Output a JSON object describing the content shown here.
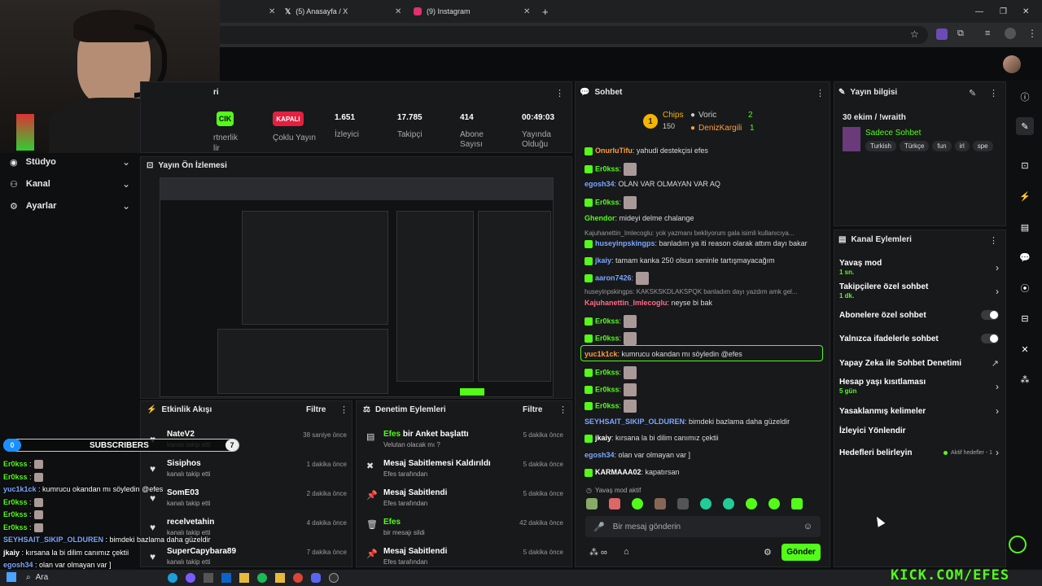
{
  "browser": {
    "tabs": [
      {
        "label": "(5) Anasayfa / X"
      },
      {
        "label": "(9) Instagram"
      }
    ]
  },
  "stats": {
    "status_label": "CIK",
    "status_partner": "rtnerlik",
    "status_partner2": "lir",
    "multi_badge": "KAPALI",
    "multi_label": "Çoklu Yayın",
    "viewers_value": "1.651",
    "viewers_label": "İzleyici",
    "followers_value": "17.785",
    "followers_label": "Takipçi",
    "subs_value": "414",
    "subs_label_1": "Abone",
    "subs_label_2": "Sayısı",
    "uptime_value": "00:49:03",
    "uptime_label_1": "Yayında",
    "uptime_label_2": "Olduğu",
    "header_partial": "ri"
  },
  "left_nav": {
    "items": [
      {
        "label": "Stüdyo"
      },
      {
        "label": "Kanal"
      },
      {
        "label": "Ayarlar"
      }
    ]
  },
  "preview": {
    "title": "Yayın Ön İzlemesi"
  },
  "activity": {
    "title": "Etkinlik Akışı",
    "filter": "Filtre",
    "items": [
      {
        "name": "NateV2",
        "sub": "kanalı takip etti",
        "time": "38 saniye önce"
      },
      {
        "name": "Sisiphos",
        "sub": "kanalı takip etti",
        "time": "1 dakika önce"
      },
      {
        "name": "SomE03",
        "sub": "kanalı takip etti",
        "time": "2 dakika önce"
      },
      {
        "name": "recelvetahin",
        "sub": "kanalı takip etti",
        "time": "4 dakika önce"
      },
      {
        "name": "SuperCapybara89",
        "sub": "kanalı takip etti",
        "time": "7 dakika önce"
      }
    ]
  },
  "moderation": {
    "title": "Denetim Eylemleri",
    "filter": "Filtre",
    "items": [
      {
        "name": "Efes",
        "action": " bir Anket başlattı",
        "sub": "Velutan olacak mı ?",
        "time": "5 dakika önce"
      },
      {
        "name": "Mesaj Sabitlemesi Kaldırıldı",
        "action": "",
        "sub": "Efes tarafından",
        "time": "5 dakika önce"
      },
      {
        "name": "Mesaj Sabitlendi",
        "action": "",
        "sub": "Efes tarafından",
        "time": "5 dakika önce"
      },
      {
        "name": "Efes",
        "action": "",
        "sub": "bir mesajı sildi",
        "time": "42 dakika önce"
      },
      {
        "name": "Mesaj Sabitlendi",
        "action": "",
        "sub": "Efes tarafından",
        "time": "5 dakika önce"
      }
    ]
  },
  "chat": {
    "title": "Sohbet",
    "chips_label": "Chips",
    "chips_value": "150",
    "top1": "Voric",
    "top1_count": "2",
    "top2": "DenizKargili",
    "top2_count": "1",
    "slow_mode_notice": "Yavaş mod aktif",
    "input_placeholder": "Bir mesaj gönderin",
    "send_label": "Gönder",
    "messages": [
      {
        "user": "OnurluTifu",
        "text": ": yahudi destekçisi efes"
      },
      {
        "user": "Er0kss",
        "text": ":"
      },
      {
        "user": "egosh34",
        "text": ": OLAN VAR OLMAYAN VAR AQ"
      },
      {
        "user": "Er0kss",
        "text": ":"
      },
      {
        "user": "Ghendor",
        "text": ": mideyi delme chalange"
      },
      {
        "user": "Kajuhanettin_Imlecoglu",
        "text": ": yok yazmanı bekliyorum gala isimli kullanıcıya..."
      },
      {
        "user": "huseyinpskingps",
        "text": ": banladım ya iti reason olarak attım dayı bakar"
      },
      {
        "user": "jkaiy",
        "text": ": tamam kanka 250 olsun seninle tartışmayacağım"
      },
      {
        "user": "aaron7426",
        "text": ":"
      },
      {
        "user": "huseyinpskingps",
        "text": ": KAKSKSKDLAKSPQK banladım dayı yazdım amk gel..."
      },
      {
        "user": "Kajuhanettin_Imlecoglu",
        "text": ": neyse bi bak"
      },
      {
        "user": "Er0kss",
        "text": ":"
      },
      {
        "user": "Er0kss",
        "text": ":"
      },
      {
        "user": "yuc1k1ck",
        "text": ": kumrucu okandan mı söyledin @efes"
      },
      {
        "user": "Er0kss",
        "text": ":"
      },
      {
        "user": "Er0kss",
        "text": ":"
      },
      {
        "user": "Er0kss",
        "text": ":"
      },
      {
        "user": "SEYHSAIT_SIKIP_OLDUREN",
        "text": ": bimdeki bazlama daha güzeldir"
      },
      {
        "user": "jkaiy",
        "text": ": kırsana la bi dilim canımız çektii"
      },
      {
        "user": "egosh34",
        "text": ": olan var olmayan var ]"
      },
      {
        "user": "KARMAAA02",
        "text": ": kapatırsan"
      }
    ]
  },
  "stream_info": {
    "title": "Yayın bilgisi",
    "stream_title": "30 ekim / !wraith",
    "category": "Sadece Sohbet",
    "tags": [
      "Turkish",
      "Türkçe",
      "fun",
      "irl",
      "spe"
    ]
  },
  "channel_actions": {
    "title": "Kanal Eylemleri",
    "items": [
      {
        "label": "Yavaş mod",
        "sub": "1 sn."
      },
      {
        "label": "Takipçilere özel sohbet",
        "sub": "1 dk."
      },
      {
        "label": "Abonelere özel sohbet",
        "sub": ""
      },
      {
        "label": "Yalnızca ifadelerle sohbet",
        "sub": ""
      },
      {
        "label": "Yapay Zeka ile Sohbet Denetimi",
        "sub": ""
      },
      {
        "label": "Hesap yaşı kısıtlaması",
        "sub": "5 gün"
      },
      {
        "label": "Yasaklanmış kelimeler",
        "sub": ""
      },
      {
        "label": "İzleyici Yönlendir",
        "sub": ""
      },
      {
        "label": "Hedefleri belirleyin",
        "sub": ""
      }
    ],
    "goals_note": "Aktif hedefler - 1"
  },
  "overlay": {
    "subs_count": "0",
    "subs_label": "SUBSCRIBERS",
    "subs_goal": "7",
    "watermark": "KICK.COM/EFES",
    "lines": [
      {
        "user": "Er0kss",
        "text": " :"
      },
      {
        "user": "Er0kss",
        "text": " :"
      },
      {
        "user": "yuc1k1ck",
        "text": " : kumrucu okandan mı söyledin @efes"
      },
      {
        "user": "Er0kss",
        "text": " :"
      },
      {
        "user": "Er0kss",
        "text": " :"
      },
      {
        "user": "Er0kss",
        "text": " :"
      },
      {
        "user": "SEYHSAIT_SIKIP_OLDUREN",
        "text": " : bimdeki bazlama daha güzeldir"
      },
      {
        "user": "jkaiy",
        "text": " : kırsana la bi dilim canımız çektii"
      },
      {
        "user": "egosh34",
        "text": " : olan var olmayan var ]"
      }
    ]
  },
  "taskbar": {
    "search": "Ara"
  },
  "colors": {
    "accent": "#53fc18",
    "panel": "#18191b",
    "background": "#0e0f10"
  }
}
